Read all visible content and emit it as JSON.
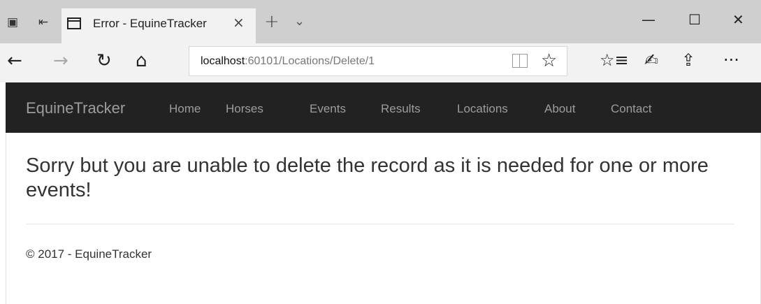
{
  "browser": {
    "tab": {
      "title": "Error - EquineTracker",
      "close_glyph": "×"
    },
    "tabbar_icons": {
      "set_aside": "▣",
      "tab_back": "⇤",
      "new_tab": "+",
      "tab_menu": "⌄"
    },
    "window_controls": {
      "minimize": "—",
      "maximize": "☐",
      "close": "✕"
    },
    "nav_glyphs": {
      "back": "←",
      "forward": "→",
      "refresh": "↻",
      "home": "⌂"
    },
    "url": {
      "host": "localhost",
      "path": ":60101/Locations/Delete/1"
    },
    "addr_icons": {
      "favorite": "☆"
    },
    "toolbar_glyphs": {
      "favorites_hub": "☆≡",
      "notes": "✍",
      "share": "⇪",
      "more": "···"
    }
  },
  "site": {
    "brand": "EquineTracker",
    "nav": [
      "Home",
      "Horses",
      "Events",
      "Results",
      "Locations",
      "About",
      "Contact"
    ]
  },
  "main": {
    "message": "Sorry but you are unable to delete the record as it is needed for one or more events!",
    "footer": "© 2017 - EquineTracker"
  },
  "colors": {
    "tabbar_bg": "#cfcfcf",
    "toolbar_bg": "#f2f2f2",
    "navbar_bg": "#222222",
    "navbar_text": "#9d9d9d"
  }
}
